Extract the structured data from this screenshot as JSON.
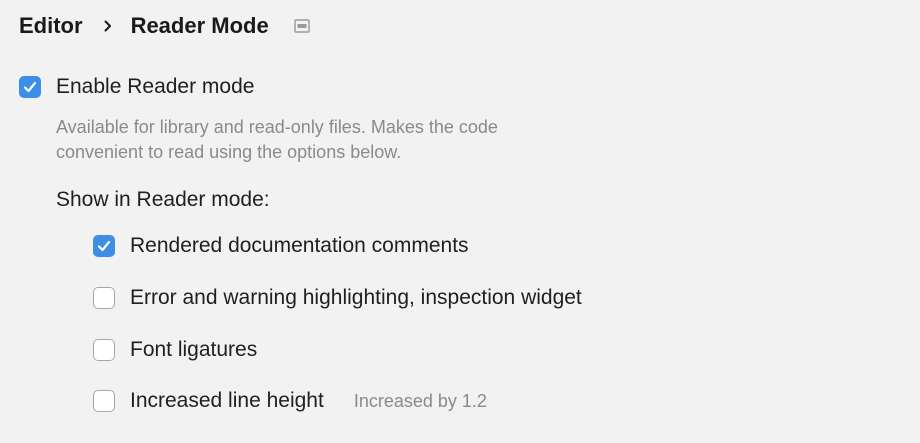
{
  "breadcrumb": {
    "parent": "Editor",
    "separator_icon": "chevron-right-icon",
    "current": "Reader Mode",
    "scope_icon": "project-scope-icon"
  },
  "enable_reader_mode": {
    "label": "Enable Reader mode",
    "checked": true,
    "hint_line1": "Available for library and read-only files. Makes the code",
    "hint_line2": "convenient to read using the options below."
  },
  "show_in_reader_mode": {
    "label": "Show in Reader mode:",
    "options": [
      {
        "label": "Rendered documentation comments",
        "checked": true
      },
      {
        "label": "Error and warning highlighting, inspection widget",
        "checked": false
      },
      {
        "label": "Font ligatures",
        "checked": false
      },
      {
        "label": "Increased line height",
        "checked": false,
        "hint": "Increased by 1.2"
      }
    ]
  },
  "colors": {
    "background": "#f2f2f2",
    "checkbox_checked": "#3d8ee6",
    "hint_text": "#8a8a8a"
  }
}
